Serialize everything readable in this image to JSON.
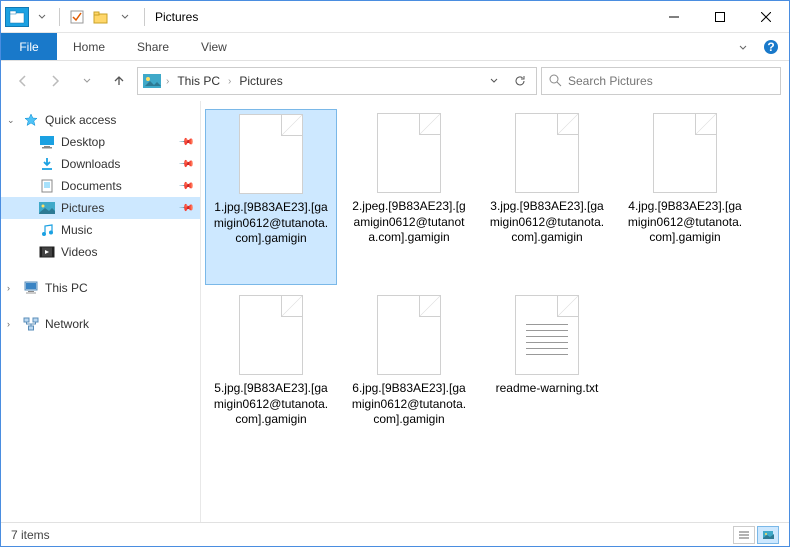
{
  "titlebar": {
    "title": "Pictures"
  },
  "ribbon": {
    "file": "File",
    "tabs": [
      "Home",
      "Share",
      "View"
    ]
  },
  "breadcrumb": {
    "parts": [
      "This PC",
      "Pictures"
    ]
  },
  "search": {
    "placeholder": "Search Pictures"
  },
  "sidebar": {
    "quick_access": {
      "label": "Quick access",
      "items": [
        {
          "label": "Desktop",
          "icon": "desktop",
          "pinned": true
        },
        {
          "label": "Downloads",
          "icon": "downloads",
          "pinned": true
        },
        {
          "label": "Documents",
          "icon": "documents",
          "pinned": true
        },
        {
          "label": "Pictures",
          "icon": "pictures",
          "pinned": true,
          "active": true
        },
        {
          "label": "Music",
          "icon": "music",
          "pinned": false
        },
        {
          "label": "Videos",
          "icon": "videos",
          "pinned": false
        }
      ]
    },
    "this_pc": {
      "label": "This PC"
    },
    "network": {
      "label": "Network"
    }
  },
  "files": [
    {
      "name": "1.jpg.[9B83AE23].[gamigin0612@tutanota.com].gamigin",
      "type": "blank",
      "selected": true
    },
    {
      "name": "2.jpeg.[9B83AE23].[gamigin0612@tutanota.com].gamigin",
      "type": "blank"
    },
    {
      "name": "3.jpg.[9B83AE23].[gamigin0612@tutanota.com].gamigin",
      "type": "blank"
    },
    {
      "name": "4.jpg.[9B83AE23].[gamigin0612@tutanota.com].gamigin",
      "type": "blank"
    },
    {
      "name": "5.jpg.[9B83AE23].[gamigin0612@tutanota.com].gamigin",
      "type": "blank"
    },
    {
      "name": "6.jpg.[9B83AE23].[gamigin0612@tutanota.com].gamigin",
      "type": "blank"
    },
    {
      "name": "readme-warning.txt",
      "type": "txt"
    }
  ],
  "status": {
    "count": "7 items"
  },
  "colors": {
    "accent": "#1979ca",
    "selection": "#cde8ff"
  }
}
